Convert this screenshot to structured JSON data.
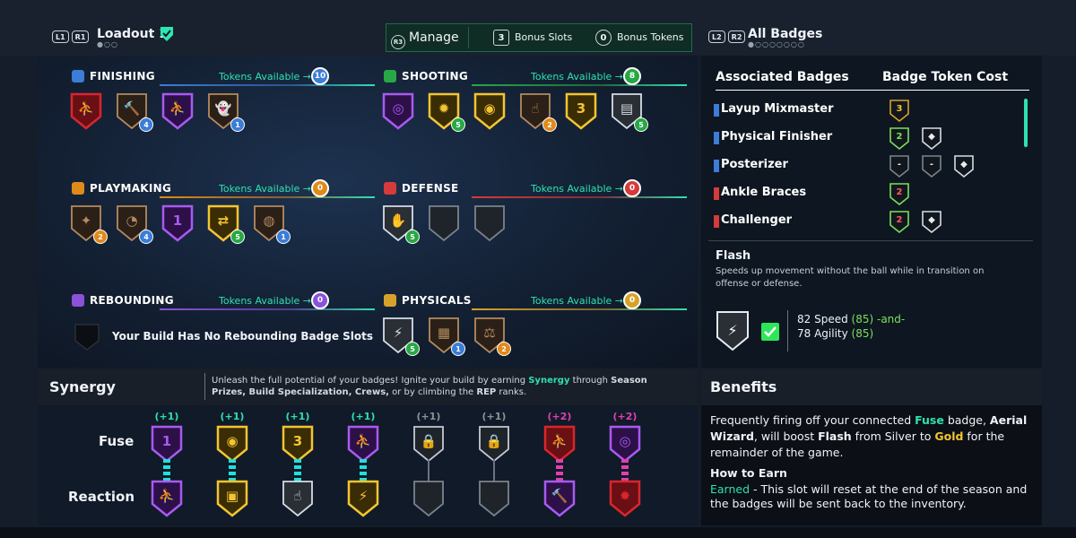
{
  "header": {
    "left_buttons": [
      "L1",
      "R1"
    ],
    "loadout_title": "Loadout 1",
    "manage_btn": "R3",
    "manage_label": "Manage",
    "bonus_slots_count": "3",
    "bonus_slots_label": "Bonus Slots",
    "bonus_tokens_count": "0",
    "bonus_tokens_label": "Bonus Tokens",
    "right_buttons": [
      "L2",
      "R2"
    ],
    "all_badges_label": "All Badges"
  },
  "categories": [
    {
      "name": "FINISHING",
      "tokens_label": "Tokens Available",
      "tokens": "10",
      "color": "#3b7dd8"
    },
    {
      "name": "SHOOTING",
      "tokens_label": "Tokens Available",
      "tokens": "8",
      "color": "#27a844"
    },
    {
      "name": "PLAYMAKING",
      "tokens_label": "Tokens Available",
      "tokens": "0",
      "color": "#e08a1a"
    },
    {
      "name": "DEFENSE",
      "tokens_label": "Tokens Available",
      "tokens": "0",
      "color": "#d63a3a"
    },
    {
      "name": "REBOUNDING",
      "tokens_label": "Tokens Available",
      "tokens": "0",
      "color": "#8a52d8"
    },
    {
      "name": "PHYSICALS",
      "tokens_label": "Tokens Available",
      "tokens": "0",
      "color": "#d6a32a"
    }
  ],
  "finishing_badges": [
    {
      "icon": "posterizer-icon",
      "tier": "ruby",
      "glyph": "⛹",
      "count": ""
    },
    {
      "icon": "hammer-icon",
      "tier": "bronze",
      "glyph": "🔨",
      "count": "4"
    },
    {
      "icon": "layup-icon",
      "tier": "amethyst",
      "glyph": "⛹",
      "count": ""
    },
    {
      "icon": "ghost-icon",
      "tier": "bronze",
      "glyph": "👻",
      "count": "1"
    }
  ],
  "shooting_badges": [
    {
      "icon": "target-icon",
      "tier": "amethyst",
      "glyph": "◎",
      "count": ""
    },
    {
      "icon": "flame-icon",
      "tier": "gold",
      "glyph": "✹",
      "count": "5"
    },
    {
      "icon": "signal-icon",
      "tier": "gold",
      "glyph": "◉",
      "count": ""
    },
    {
      "icon": "hand-icon",
      "tier": "bronze",
      "glyph": "☝",
      "count": "2"
    },
    {
      "icon": "three-icon",
      "tier": "gold",
      "glyph": "3",
      "count": ""
    },
    {
      "icon": "chart-icon",
      "tier": "silver",
      "glyph": "▤",
      "count": "5"
    }
  ],
  "playmaking_badges": [
    {
      "icon": "dribble-icon",
      "tier": "bronze",
      "glyph": "✦",
      "count": "2"
    },
    {
      "icon": "gauge-icon",
      "tier": "bronze",
      "glyph": "◔",
      "count": "4"
    },
    {
      "icon": "one-icon",
      "tier": "amethyst",
      "glyph": "1",
      "count": ""
    },
    {
      "icon": "swap-icon",
      "tier": "gold",
      "glyph": "⇄",
      "count": "5"
    },
    {
      "icon": "ball-icon",
      "tier": "bronze",
      "glyph": "◍",
      "count": "1"
    }
  ],
  "defense_badges": [
    {
      "icon": "shield-hand-icon",
      "tier": "silver",
      "glyph": "✋",
      "count": "5"
    },
    {
      "icon": "empty-slot-icon",
      "tier": "empty",
      "glyph": "",
      "count": ""
    },
    {
      "icon": "empty-slot-icon",
      "tier": "empty",
      "glyph": "",
      "count": ""
    }
  ],
  "rebounding_message": "Your Build Has No Rebounding Badge Slots",
  "physicals_badges": [
    {
      "icon": "flash-icon",
      "tier": "silver",
      "glyph": "⚡",
      "count": "5"
    },
    {
      "icon": "brick-icon",
      "tier": "bronze",
      "glyph": "▦",
      "count": "1"
    },
    {
      "icon": "strength-icon",
      "tier": "bronze",
      "glyph": "⚖",
      "count": "2"
    }
  ],
  "associated": {
    "title": "Associated Badges",
    "cost_title": "Badge Token Cost",
    "rows": [
      {
        "name": "Layup Mixmaster",
        "bar_color": "#3b7dd8",
        "costs": [
          "3"
        ]
      },
      {
        "name": "Physical Finisher",
        "bar_color": "#3b7dd8",
        "costs": [
          "2",
          ""
        ]
      },
      {
        "name": "Posterizer",
        "bar_color": "#3b7dd8",
        "costs": [
          "-",
          "-",
          ""
        ]
      },
      {
        "name": "Ankle Braces",
        "bar_color": "#d63a3a",
        "costs": [
          "2"
        ]
      },
      {
        "name": "Challenger",
        "bar_color": "#d63a3a",
        "costs": [
          "2",
          ""
        ]
      }
    ]
  },
  "flash": {
    "name": "Flash",
    "desc": "Speeds up movement without the ball while in transition on offense or defense.",
    "req1": "82 Speed",
    "req1_val": "(85)",
    "and_text": "-and-",
    "req2": "78 Agility",
    "req2_val": "(85)"
  },
  "synergy": {
    "title": "Synergy",
    "desc_1": "Unleash the full potential of your badges! Ignite your build by earning ",
    "desc_synergy": "Synergy",
    "desc_2": " through ",
    "desc_b1": "Season Prizes, Build Specialization, Crews,",
    "desc_3": " or by climbing the ",
    "desc_b2": "REP",
    "desc_4": " ranks.",
    "fuse_label": "Fuse",
    "reaction_label": "Reaction",
    "columns": [
      {
        "plus": "(+1)",
        "active": true,
        "fuse": {
          "tier": "amethyst",
          "glyph": "1",
          "icon": "one-icon"
        },
        "reaction": {
          "tier": "amethyst",
          "glyph": "⛹",
          "icon": "layup-icon"
        },
        "link": "#21e0d8"
      },
      {
        "plus": "(+1)",
        "active": true,
        "fuse": {
          "tier": "gold",
          "glyph": "◉",
          "icon": "signal-icon"
        },
        "reaction": {
          "tier": "gold",
          "glyph": "▣",
          "icon": "board-icon"
        },
        "link": "#21e0d8"
      },
      {
        "plus": "(+1)",
        "active": true,
        "fuse": {
          "tier": "gold",
          "glyph": "3",
          "icon": "three-icon"
        },
        "reaction": {
          "tier": "silver",
          "glyph": "☝",
          "icon": "hand-icon"
        },
        "link": "#21e0d8"
      },
      {
        "plus": "(+1)",
        "active": true,
        "fuse": {
          "tier": "amethyst",
          "glyph": "⛹",
          "icon": "layup-icon"
        },
        "reaction": {
          "tier": "gold",
          "glyph": "⚡",
          "icon": "flash-icon"
        },
        "link": "#21e0d8"
      },
      {
        "plus": "(+1)",
        "active": false,
        "fuse": {
          "tier": "locked",
          "glyph": "🔒",
          "icon": "lock-icon"
        },
        "reaction": {
          "tier": "empty",
          "glyph": "",
          "icon": "empty-slot-icon"
        },
        "link": "#6b7380"
      },
      {
        "plus": "(+1)",
        "active": false,
        "fuse": {
          "tier": "locked",
          "glyph": "🔒",
          "icon": "lock-icon"
        },
        "reaction": {
          "tier": "empty",
          "glyph": "",
          "icon": "empty-slot-icon"
        },
        "link": "#6b7380"
      },
      {
        "plus": "(+2)",
        "active": true,
        "fuse": {
          "tier": "ruby",
          "glyph": "⛹",
          "icon": "posterizer-icon"
        },
        "reaction": {
          "tier": "amethyst",
          "glyph": "🔨",
          "icon": "hammer-icon"
        },
        "link": "#e23fb0"
      },
      {
        "plus": "(+2)",
        "active": true,
        "fuse": {
          "tier": "amethyst",
          "glyph": "◎",
          "icon": "target-icon"
        },
        "reaction": {
          "tier": "ruby",
          "glyph": "✹",
          "icon": "flame-icon"
        },
        "link": "#e23fb0"
      }
    ]
  },
  "benefits": {
    "title": "Benefits",
    "t1": "Frequently firing off your connected ",
    "fuse": "Fuse",
    "t2": " badge, ",
    "aerial": "Aerial Wizard",
    "t3": ", will boost ",
    "flash": "Flash",
    "t4": " from Silver to ",
    "gold": "Gold",
    "t5": " for the remainder of the game.",
    "how_title": "How to Earn",
    "earned": "Earned",
    "how_text": " - This slot will reset at the end of the season and the badges will be sent back to the inventory."
  },
  "tier_colors": {
    "ruby": [
      "#6a0f14",
      "#d8262d"
    ],
    "amethyst": [
      "#2d1048",
      "#a75bf0"
    ],
    "gold": [
      "#3a2c05",
      "#f2c531"
    ],
    "silver": [
      "#2a2f36",
      "#d6dde6"
    ],
    "bronze": [
      "#2a2017",
      "#b58a5e"
    ],
    "empty": [
      "#1f242b",
      "#7b838d"
    ],
    "locked": [
      "#1f242b",
      "#c4cad2"
    ]
  }
}
